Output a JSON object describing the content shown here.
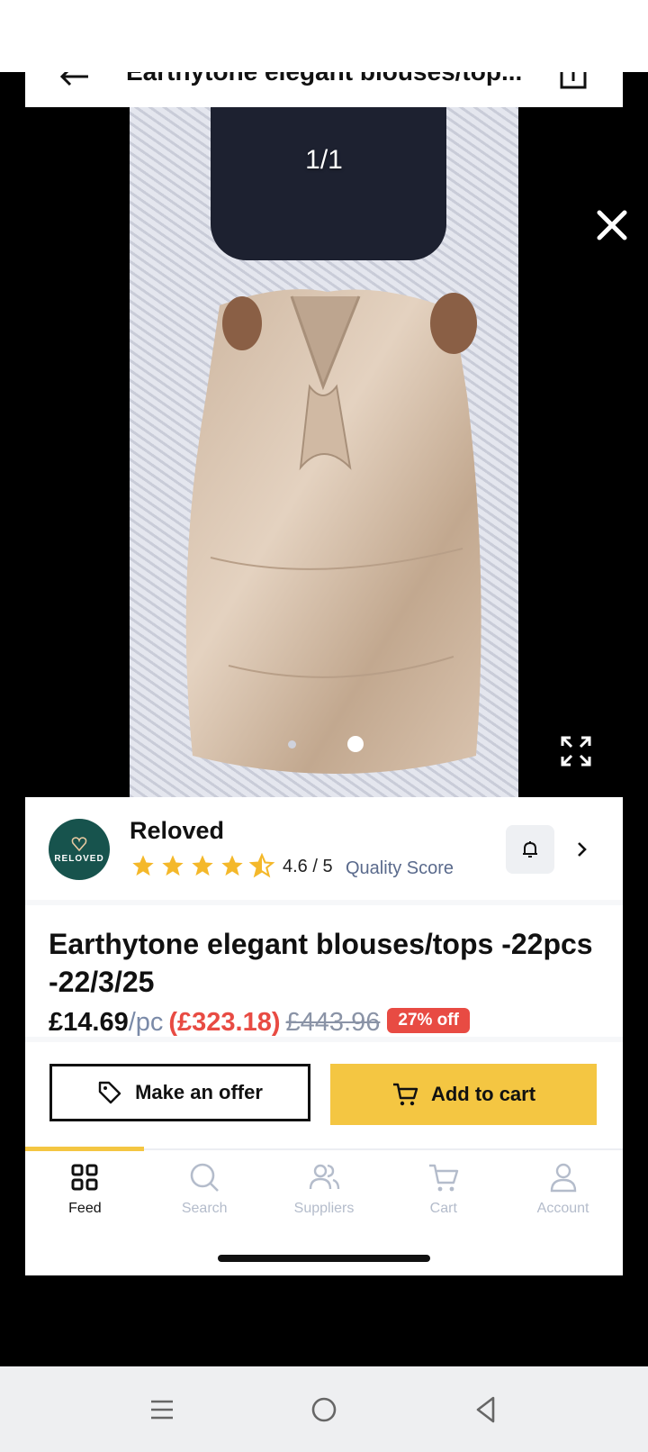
{
  "header": {
    "title": "Earthytone elegant blouses/top..."
  },
  "gallery": {
    "counter": "1/1"
  },
  "seller": {
    "name": "Reloved",
    "logo_text": "RELOVED",
    "rating": "4.6 / 5",
    "quality_label": "Quality Score",
    "stars": 4.5
  },
  "product": {
    "title": "Earthytone elegant blouses/tops -22pcs -22/3/25",
    "price": "£14.69",
    "unit": "/pc",
    "total": "(£323.18)",
    "old_price": "£443.96",
    "discount": "27% off"
  },
  "actions": {
    "offer_label": "Make an offer",
    "cart_label": "Add to cart"
  },
  "nav": {
    "feed": "Feed",
    "search": "Search",
    "suppliers": "Suppliers",
    "cart": "Cart",
    "account": "Account"
  },
  "colors": {
    "accent": "#f4c642",
    "sale": "#e84b43",
    "avatar": "#17534d"
  }
}
